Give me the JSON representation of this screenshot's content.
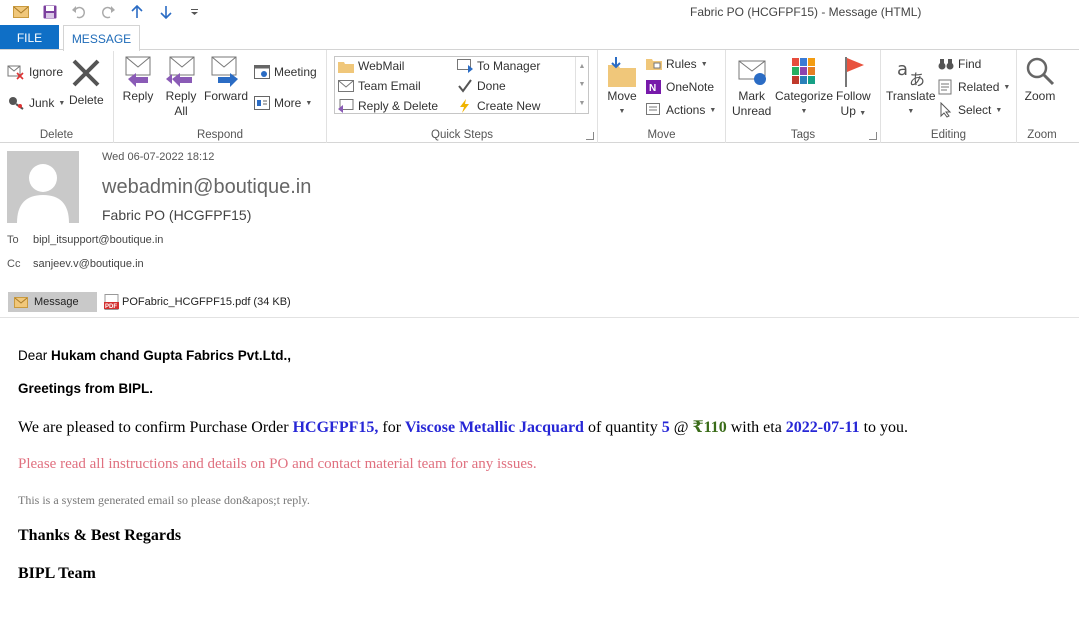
{
  "window": {
    "title": "Fabric PO (HCGFPF15) - Message (HTML)"
  },
  "tabs": {
    "file": "FILE",
    "message": "MESSAGE"
  },
  "ribbon": {
    "delete_group": {
      "label": "Delete",
      "ignore": "Ignore",
      "junk": "Junk",
      "delete": "Delete"
    },
    "respond_group": {
      "label": "Respond",
      "reply": "Reply",
      "reply_all_1": "Reply",
      "reply_all_2": "All",
      "forward": "Forward",
      "meeting": "Meeting",
      "more": "More"
    },
    "quick_steps": {
      "label": "Quick Steps",
      "items": [
        "WebMail",
        "Team Email",
        "Reply & Delete",
        "To Manager",
        "Done",
        "Create New"
      ]
    },
    "move_group": {
      "label": "Move",
      "move": "Move",
      "rules": "Rules",
      "onenote": "OneNote",
      "actions": "Actions"
    },
    "tags_group": {
      "label": "Tags",
      "mark_unread_1": "Mark",
      "mark_unread_2": "Unread",
      "categorize": "Categorize",
      "follow_up_1": "Follow",
      "follow_up_2": "Up"
    },
    "editing_group": {
      "label": "Editing",
      "translate": "Translate",
      "find": "Find",
      "related": "Related",
      "select": "Select"
    },
    "zoom_group": {
      "label": "Zoom",
      "zoom": "Zoom"
    }
  },
  "message": {
    "date": "Wed 06-07-2022 18:12",
    "sender": "webadmin@boutique.in",
    "subject": "Fabric PO (HCGFPF15)",
    "to_label": "To",
    "to": "bipl_itsupport@boutique.in",
    "cc_label": "Cc",
    "cc": "sanjeev.v@boutique.in",
    "attachments": {
      "message_label": "Message",
      "file": "POFabric_HCGFPF15.pdf (34 KB)"
    }
  },
  "body": {
    "dear": "Dear ",
    "recipient": "Hukam chand Gupta Fabrics Pvt.Ltd.,",
    "greeting": "Greetings from BIPL.",
    "p1_a": "We are pleased to confirm Purchase Order ",
    "po": "HCGFPF15,",
    "p1_b": " for ",
    "item": "Viscose Metallic Jacquard",
    "p1_c": " of quantity ",
    "qty": "5",
    "p1_d": " @ ",
    "price": "₹110",
    "p1_e": " with eta ",
    "eta": "2022-07-11",
    "p1_f": " to you.",
    "instructions": "Please read all instructions and details on PO and contact material team for any issues.",
    "system_note": "This is a system generated email so please don&apos;t reply.",
    "thanks": "Thanks & Best Regards",
    "team": "BIPL Team"
  },
  "colors": {
    "accent": "#0f6fc6",
    "highlight_blue": "#2727d6",
    "price_green": "#3a6c19",
    "instructions_pink": "#e0707f"
  }
}
